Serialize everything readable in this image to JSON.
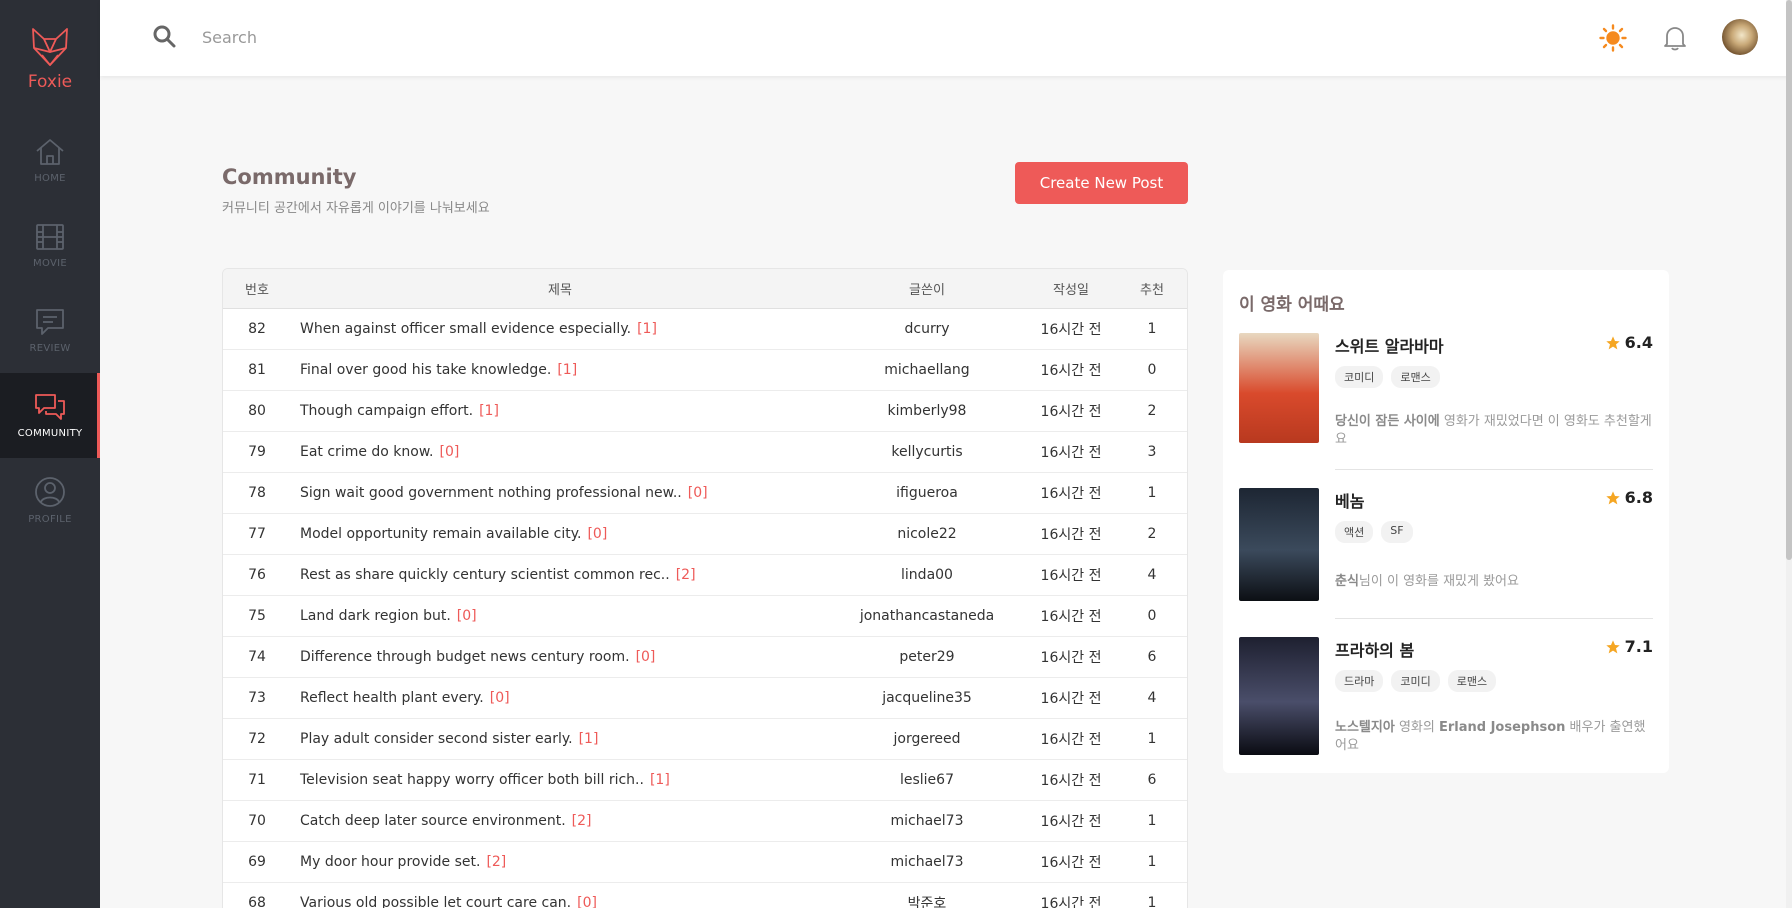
{
  "brand": {
    "name": "Foxie"
  },
  "nav": [
    {
      "key": "home",
      "label": "HOME"
    },
    {
      "key": "movie",
      "label": "MOVIE"
    },
    {
      "key": "review",
      "label": "REVIEW"
    },
    {
      "key": "community",
      "label": "COMMUNITY",
      "active": true
    },
    {
      "key": "profile",
      "label": "PROFILE"
    }
  ],
  "search": {
    "placeholder": "Search",
    "value": ""
  },
  "header": {
    "title": "Community",
    "subtitle": "커뮤니티 공간에서 자유롭게 이야기를 나눠보세요",
    "create_label": "Create New Post"
  },
  "table": {
    "columns": [
      "번호",
      "제목",
      "글쓴이",
      "작성일",
      "추천"
    ],
    "rows": [
      {
        "no": "82",
        "title": "When against officer small evidence especially.",
        "comments": "[1]",
        "author": "dcurry",
        "date": "16시간 전",
        "likes": "1"
      },
      {
        "no": "81",
        "title": "Final over good his take knowledge.",
        "comments": "[1]",
        "author": "michaellang",
        "date": "16시간 전",
        "likes": "0"
      },
      {
        "no": "80",
        "title": "Though campaign effort.",
        "comments": "[1]",
        "author": "kimberly98",
        "date": "16시간 전",
        "likes": "2"
      },
      {
        "no": "79",
        "title": "Eat crime do know.",
        "comments": "[0]",
        "author": "kellycurtis",
        "date": "16시간 전",
        "likes": "3"
      },
      {
        "no": "78",
        "title": "Sign wait good government nothing professional new..",
        "comments": "[0]",
        "author": "ifigueroa",
        "date": "16시간 전",
        "likes": "1"
      },
      {
        "no": "77",
        "title": "Model opportunity remain available city.",
        "comments": "[0]",
        "author": "nicole22",
        "date": "16시간 전",
        "likes": "2"
      },
      {
        "no": "76",
        "title": "Rest as share quickly century scientist common rec..",
        "comments": "[2]",
        "author": "linda00",
        "date": "16시간 전",
        "likes": "4"
      },
      {
        "no": "75",
        "title": "Land dark region but.",
        "comments": "[0]",
        "author": "jonathancastaneda",
        "date": "16시간 전",
        "likes": "0"
      },
      {
        "no": "74",
        "title": "Difference through budget news century room.",
        "comments": "[0]",
        "author": "peter29",
        "date": "16시간 전",
        "likes": "6"
      },
      {
        "no": "73",
        "title": "Reflect health plant every.",
        "comments": "[0]",
        "author": "jacqueline35",
        "date": "16시간 전",
        "likes": "4"
      },
      {
        "no": "72",
        "title": "Play adult consider second sister early.",
        "comments": "[1]",
        "author": "jorgereed",
        "date": "16시간 전",
        "likes": "1"
      },
      {
        "no": "71",
        "title": "Television seat happy worry officer both bill rich..",
        "comments": "[1]",
        "author": "leslie67",
        "date": "16시간 전",
        "likes": "6"
      },
      {
        "no": "70",
        "title": "Catch deep later source environment.",
        "comments": "[2]",
        "author": "michael73",
        "date": "16시간 전",
        "likes": "1"
      },
      {
        "no": "69",
        "title": "My door hour provide set.",
        "comments": "[2]",
        "author": "michael73",
        "date": "16시간 전",
        "likes": "1"
      },
      {
        "no": "68",
        "title": "Various old possible let court care can.",
        "comments": "[0]",
        "author": "박준호",
        "date": "16시간 전",
        "likes": "1"
      }
    ]
  },
  "recommend": {
    "title": "이 영화 어때요",
    "movies": [
      {
        "title": "스위트 알라바마",
        "rating": "6.4",
        "tags": [
          "코미디",
          "로맨스"
        ],
        "desc_bold": "당신이 잠든 사이에",
        "desc_rest": " 영화가 재밌었다면 이 영화도 추천할게요",
        "poster_colors": [
          "#e8d8c0",
          "#d94a2c",
          "#b8391f"
        ]
      },
      {
        "title": "베놈",
        "rating": "6.8",
        "tags": [
          "액션",
          "SF"
        ],
        "desc_bold": "춘식",
        "desc_rest": "님이 이 영화를 재밌게 봤어요",
        "poster_colors": [
          "#1d2633",
          "#3b4a5c",
          "#0c0f14"
        ]
      },
      {
        "title": "프라하의 봄",
        "rating": "7.1",
        "tags": [
          "드라마",
          "코미디",
          "로맨스"
        ],
        "desc_bold": "노스텔지아",
        "desc_mid": " 영화의 ",
        "desc_bold2": "Erland Josephson",
        "desc_rest": " 배우가 출연했어요",
        "poster_colors": [
          "#1e2030",
          "#4a4e6a",
          "#0a0b12"
        ]
      }
    ]
  },
  "colors": {
    "accent": "#ee5a58",
    "sidebar": "#2c2f36",
    "star": "#f5a623",
    "sun": "#f58a1f"
  }
}
